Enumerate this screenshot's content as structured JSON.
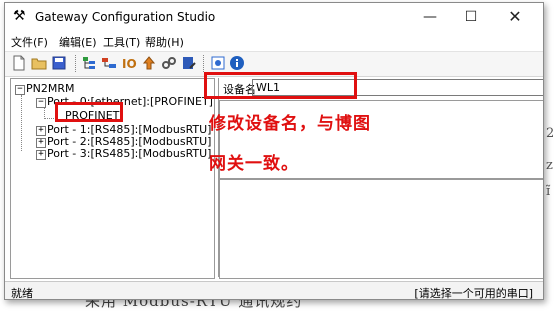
{
  "window": {
    "title": "Gateway Configuration Studio",
    "controls": {
      "minimize": "—",
      "maximize": "☐",
      "close": "✕"
    }
  },
  "menu": [
    {
      "label": "文件(F)"
    },
    {
      "label": "编辑(E)"
    },
    {
      "label": "工具(T)"
    },
    {
      "label": "帮助(H)"
    }
  ],
  "toolbar": {
    "icons": [
      "new-file-icon",
      "open-folder-icon",
      "save-icon",
      "add-node-icon",
      "add-device-icon",
      "io-icon",
      "upload-icon",
      "link-icon",
      "edit-icon",
      "network-config-icon",
      "info-icon"
    ]
  },
  "tree": {
    "root": "PN2MRM",
    "ports": [
      "Port - 0:[ethernet]:[PROFINET]",
      "Port - 1:[RS485]:[ModbusRTU]",
      "Port - 2:[RS485]:[ModbusRTU]",
      "Port - 3:[RS485]:[ModbusRTU]"
    ],
    "device": "PROFINET"
  },
  "detail": {
    "device_name_label": "设备名",
    "device_name_value": "WL1"
  },
  "annotation": {
    "line1": "修改设备名，与博图",
    "line2": "网关一致。",
    "color": "#e01010"
  },
  "status": {
    "left": "就绪",
    "right": "[请选择一个可用的串口]"
  },
  "background": {
    "bottom_text": "采用 Modbus-RTU 通讯规约"
  }
}
